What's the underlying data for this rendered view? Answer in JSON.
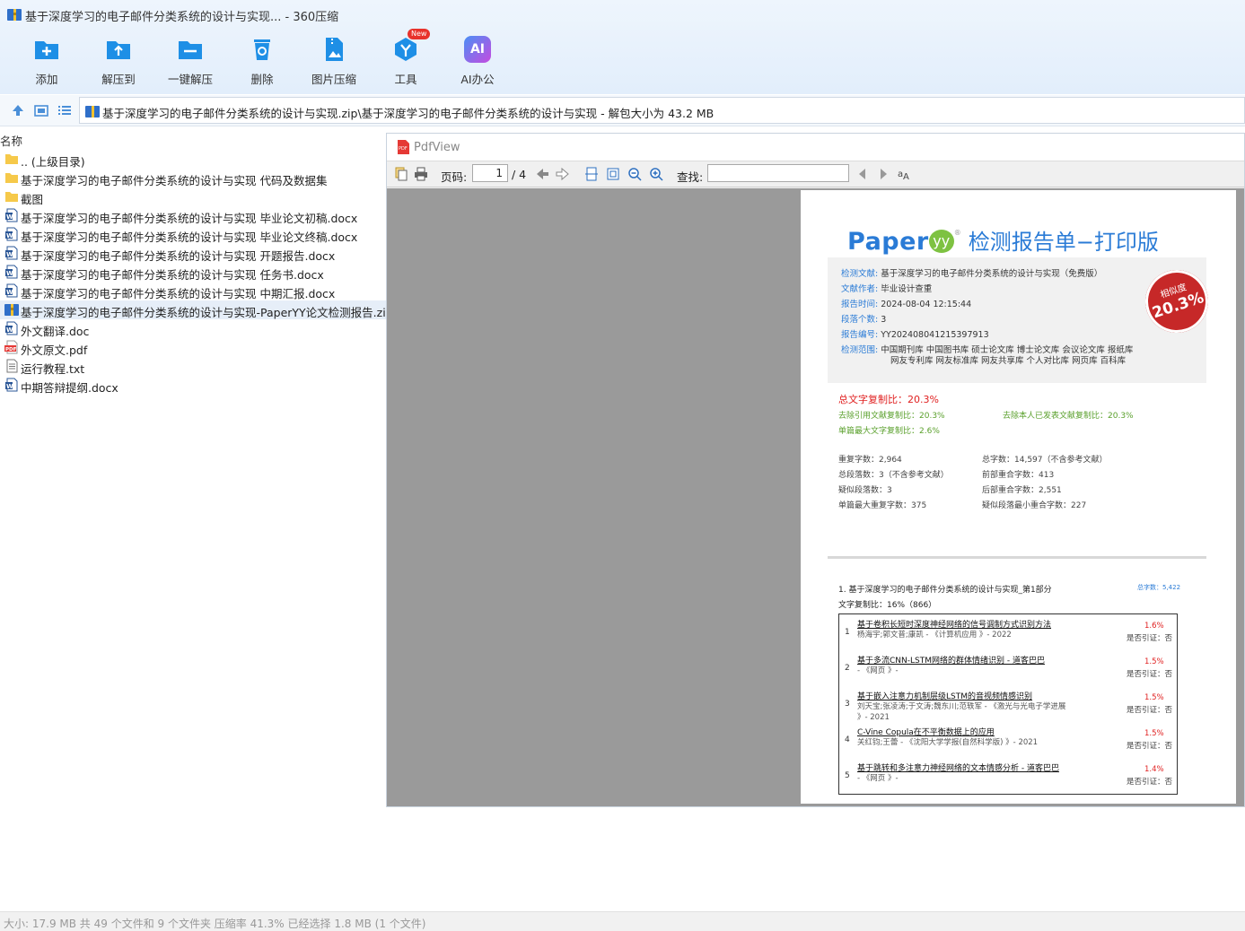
{
  "window": {
    "title": "基于深度学习的电子邮件分类系统的设计与实现... - 360压缩"
  },
  "toolbar": {
    "buttons": [
      {
        "label": "添加",
        "icon": "add-icon"
      },
      {
        "label": "解压到",
        "icon": "extract-to-icon"
      },
      {
        "label": "一键解压",
        "icon": "one-click-extract-icon"
      },
      {
        "label": "删除",
        "icon": "delete-icon"
      },
      {
        "label": "图片压缩",
        "icon": "image-compress-icon"
      },
      {
        "label": "工具",
        "icon": "tools-icon",
        "badge": "New"
      },
      {
        "label": "AI办公",
        "icon": "ai-office-icon",
        "icon_text": "AI"
      }
    ]
  },
  "address": {
    "path": "基于深度学习的电子邮件分类系统的设计与实现.zip\\基于深度学习的电子邮件分类系统的设计与实现 - 解包大小为 43.2 MB"
  },
  "filelist": {
    "column_name": "名称",
    "items": [
      {
        "name": ".. (上级目录)",
        "type": "folder"
      },
      {
        "name": "基于深度学习的电子邮件分类系统的设计与实现 代码及数据集",
        "type": "folder"
      },
      {
        "name": "截图",
        "type": "folder"
      },
      {
        "name": "基于深度学习的电子邮件分类系统的设计与实现 毕业论文初稿.docx",
        "type": "word"
      },
      {
        "name": "基于深度学习的电子邮件分类系统的设计与实现 毕业论文终稿.docx",
        "type": "word"
      },
      {
        "name": "基于深度学习的电子邮件分类系统的设计与实现 开题报告.docx",
        "type": "word"
      },
      {
        "name": "基于深度学习的电子邮件分类系统的设计与实现 任务书.docx",
        "type": "word"
      },
      {
        "name": "基于深度学习的电子邮件分类系统的设计与实现 中期汇报.docx",
        "type": "word"
      },
      {
        "name": "基于深度学习的电子邮件分类系统的设计与实现-PaperYY论文检测报告.zip",
        "type": "zip",
        "selected": true
      },
      {
        "name": "外文翻译.doc",
        "type": "word"
      },
      {
        "name": "外文原文.pdf",
        "type": "pdf"
      },
      {
        "name": "运行教程.txt",
        "type": "txt"
      },
      {
        "name": "中期答辩提纲.docx",
        "type": "word"
      }
    ]
  },
  "pdfview": {
    "title": "PdfView",
    "page_label": "页码:",
    "page_current": "1",
    "page_total": "/ 4",
    "find_label": "查找:",
    "find_value": ""
  },
  "report": {
    "logo": "Paper",
    "logo_mark": "yy",
    "logo_reg": "®",
    "heading": "检测报告单−打印版",
    "info": [
      {
        "key": "检测文献:",
        "value": "基于深度学习的电子邮件分类系统的设计与实现（免费版）"
      },
      {
        "key": "文献作者:",
        "value": "毕业设计查重"
      },
      {
        "key": "报告时间:",
        "value": "2024-08-04 12:15:44"
      },
      {
        "key": "段落个数:",
        "value": "3"
      },
      {
        "key": "报告编号:",
        "value": "YY202408041215397913"
      },
      {
        "key": "检测范围:",
        "value": "中国期刊库  中国图书库  硕士论文库  博士论文库  会议论文库  报纸库"
      },
      {
        "key": "",
        "value": "网友专利库  网友标准库  网友共享库  个人对比库  网页库  百科库"
      }
    ],
    "stamp_label": "相似度",
    "stamp_value": "20.3%",
    "total_ratio": "总文字复制比：20.3%",
    "ex_cite": "去除引用文献复制比：20.3%",
    "ex_self": "去除本人已发表文献复制比：20.3%",
    "max_single": "单篇最大文字复制比：2.6%",
    "stats_left": [
      "重复字数：2,964",
      "总段落数：3（不含参考文献）",
      "疑似段落数：3",
      "单篇最大重复字数：375"
    ],
    "stats_right": [
      "总字数：14,597（不含参考文献）",
      "前部重合字数：413",
      "后部重合字数：2,551",
      "疑似段落最小重合字数：227"
    ],
    "section_title": "1. 基于深度学习的电子邮件分类系统的设计与实现_第1部分",
    "section_total": "总字数：5,422",
    "section_ratio": "文字复制比：16%（866）",
    "sources": [
      {
        "n": "1",
        "title": "基于卷积长短时深度神经网络的信号调制方式识别方法",
        "author": "杨海宇;郭文普;康凯 - 《计算机应用 》- 2022",
        "author2": "",
        "pct": "1.6%",
        "cite": "是否引证：否"
      },
      {
        "n": "2",
        "title": "基于多流CNN-LSTM网络的群体情绪识别 - 道客巴巴",
        "author": "- 《网页 》-",
        "author2": "",
        "pct": "1.5%",
        "cite": "是否引证：否"
      },
      {
        "n": "3",
        "title": "基于嵌入注意力机制层级LSTM的音视频情感识别",
        "author": "刘天宝;张凌涛;于文涛;魏东川;范轶军 - 《激光与光电子学进展",
        "author2": "》- 2021",
        "pct": "1.5%",
        "cite": "是否引证：否"
      },
      {
        "n": "4",
        "title": "C-Vine Copula在不平衡数据上的应用",
        "author": "关红钧;王蕾 - 《沈阳大学学报(自然科学版) 》- 2021",
        "author2": "",
        "pct": "1.5%",
        "cite": "是否引证：否"
      },
      {
        "n": "5",
        "title": "基于跳转和多注意力神经网络的文本情感分析 - 道客巴巴",
        "author": "- 《网页 》-",
        "author2": "",
        "pct": "1.4%",
        "cite": "是否引证：否"
      }
    ]
  },
  "status": {
    "text": "大小: 17.9 MB 共 49 个文件和 9 个文件夹 压缩率 41.3% 已经选择 1.8 MB (1 个文件)"
  },
  "colors": {
    "accent": "#2a7bd6",
    "selected_row": "#e6eef8",
    "stamp": "#c62828"
  }
}
